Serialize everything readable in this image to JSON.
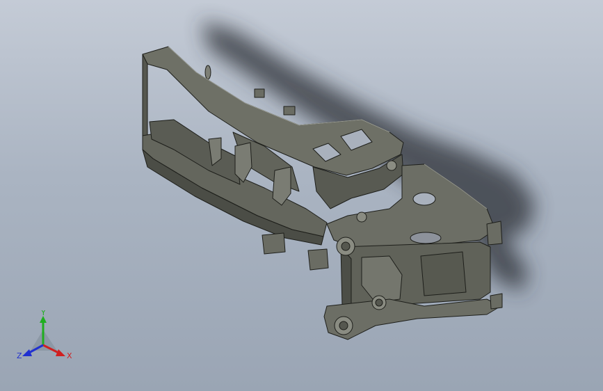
{
  "viewport": {
    "background_top": "#c4cbd6",
    "background_bottom": "#9aa5b4",
    "model_color": "#6a6c63",
    "model_edge_color": "#1d1e1a",
    "shadow_color": "#2f3338"
  },
  "triad": {
    "x_label": "X",
    "y_label": "Y",
    "z_label": "Z",
    "x_color": "#d02020",
    "y_color": "#1fae1f",
    "z_color": "#2030d0"
  }
}
